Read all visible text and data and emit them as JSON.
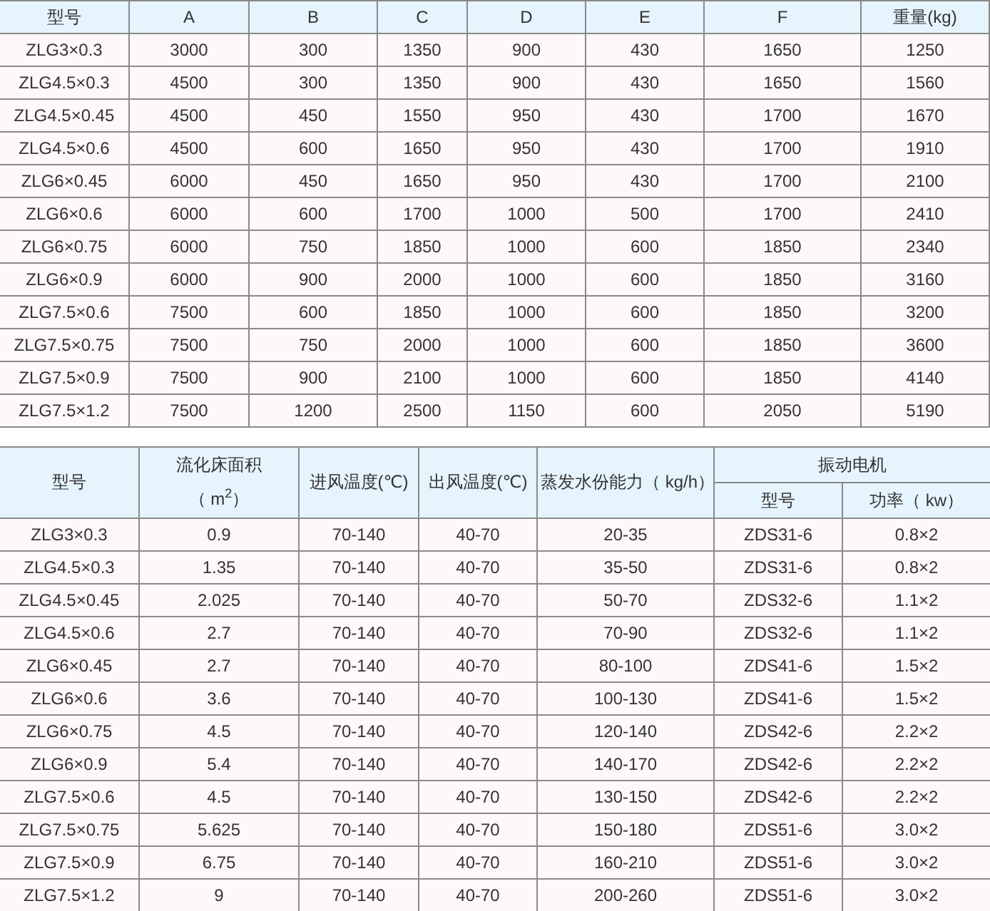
{
  "spec_table": {
    "columns": [
      {
        "label": "型号"
      },
      {
        "label": "A"
      },
      {
        "label": "B"
      },
      {
        "label": "C"
      },
      {
        "label": "D"
      },
      {
        "label": "E"
      },
      {
        "label": "F"
      },
      {
        "label": "重量(kg)"
      }
    ],
    "rows": [
      [
        "ZLG3×0.3",
        "3000",
        "300",
        "1350",
        "900",
        "430",
        "1650",
        "1250"
      ],
      [
        "ZLG4.5×0.3",
        "4500",
        "300",
        "1350",
        "900",
        "430",
        "1650",
        "1560"
      ],
      [
        "ZLG4.5×0.45",
        "4500",
        "450",
        "1550",
        "950",
        "430",
        "1700",
        "1670"
      ],
      [
        "ZLG4.5×0.6",
        "4500",
        "600",
        "1650",
        "950",
        "430",
        "1700",
        "1910"
      ],
      [
        "ZLG6×0.45",
        "6000",
        "450",
        "1650",
        "950",
        "430",
        "1700",
        "2100"
      ],
      [
        "ZLG6×0.6",
        "6000",
        "600",
        "1700",
        "1000",
        "500",
        "1700",
        "2410"
      ],
      [
        "ZLG6×0.75",
        "6000",
        "750",
        "1850",
        "1000",
        "600",
        "1850",
        "2340"
      ],
      [
        "ZLG6×0.9",
        "6000",
        "900",
        "2000",
        "1000",
        "600",
        "1850",
        "3160"
      ],
      [
        "ZLG7.5×0.6",
        "7500",
        "600",
        "1850",
        "1000",
        "600",
        "1850",
        "3200"
      ],
      [
        "ZLG7.5×0.75",
        "7500",
        "750",
        "2000",
        "1000",
        "600",
        "1850",
        "3600"
      ],
      [
        "ZLG7.5×0.9",
        "7500",
        "900",
        "2100",
        "1000",
        "600",
        "1850",
        "4140"
      ],
      [
        "ZLG7.5×1.2",
        "7500",
        "1200",
        "2500",
        "1150",
        "600",
        "2050",
        "5190"
      ]
    ]
  },
  "performance_table": {
    "columns": [
      {
        "label": "型号"
      },
      {
        "label": "流化床面积",
        "sublabel": "（ m$^{2}$）"
      },
      {
        "label": "进风温度(℃)"
      },
      {
        "label": "出风温度(℃)"
      },
      {
        "label": "蒸发水份能力（ kg/h）"
      },
      {
        "label": "振动电机",
        "colspan": 2,
        "children": [
          {
            "label": "型号"
          },
          {
            "label": "功率（ kw）"
          }
        ]
      }
    ],
    "rows": [
      [
        "ZLG3×0.3",
        "0.9",
        "70-140",
        "40-70",
        "20-35",
        "ZDS31-6",
        "0.8×2"
      ],
      [
        "ZLG4.5×0.3",
        "1.35",
        "70-140",
        "40-70",
        "35-50",
        "ZDS31-6",
        "0.8×2"
      ],
      [
        "ZLG4.5×0.45",
        "2.025",
        "70-140",
        "40-70",
        "50-70",
        "ZDS32-6",
        "1.1×2"
      ],
      [
        "ZLG4.5×0.6",
        "2.7",
        "70-140",
        "40-70",
        "70-90",
        "ZDS32-6",
        "1.1×2"
      ],
      [
        "ZLG6×0.45",
        "2.7",
        "70-140",
        "40-70",
        "80-100",
        "ZDS41-6",
        "1.5×2"
      ],
      [
        "ZLG6×0.6",
        "3.6",
        "70-140",
        "40-70",
        "100-130",
        "ZDS41-6",
        "1.5×2"
      ],
      [
        "ZLG6×0.75",
        "4.5",
        "70-140",
        "40-70",
        "120-140",
        "ZDS42-6",
        "2.2×2"
      ],
      [
        "ZLG6×0.9",
        "5.4",
        "70-140",
        "40-70",
        "140-170",
        "ZDS42-6",
        "2.2×2"
      ],
      [
        "ZLG7.5×0.6",
        "4.5",
        "70-140",
        "40-70",
        "130-150",
        "ZDS42-6",
        "2.2×2"
      ],
      [
        "ZLG7.5×0.75",
        "5.625",
        "70-140",
        "40-70",
        "150-180",
        "ZDS51-6",
        "3.0×2"
      ],
      [
        "ZLG7.5×0.9",
        "6.75",
        "70-140",
        "40-70",
        "160-210",
        "ZDS51-6",
        "3.0×2"
      ],
      [
        "ZLG7.5×1.2",
        "9",
        "70-140",
        "40-70",
        "200-260",
        "ZDS51-6",
        "3.0×2"
      ]
    ]
  }
}
